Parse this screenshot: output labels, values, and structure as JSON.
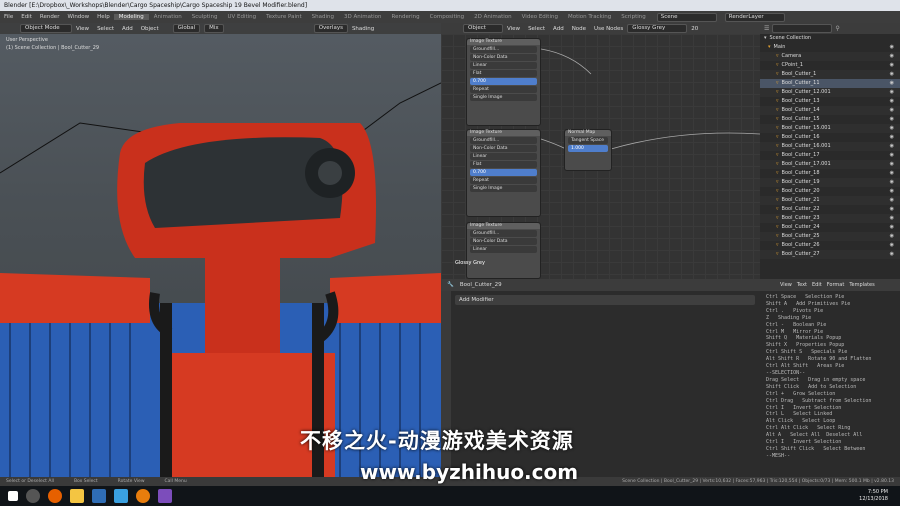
{
  "window": {
    "title": "Blender [E:\\Dropbox\\_Workshops\\Blender\\Cargo Spaceship\\Cargo Spaceship 19 Bevel Modifier.blend]"
  },
  "menubar": {
    "menus": [
      "File",
      "Edit",
      "Render",
      "Window",
      "Help"
    ],
    "workspaces": [
      "Modeling",
      "Animation",
      "Sculpting",
      "UV Editing",
      "Texture Paint",
      "Shading",
      "3D Animation",
      "Rendering",
      "Compositing",
      "2D Animation",
      "Video Editing",
      "Motion Tracking",
      "Scripting"
    ],
    "active_workspace": "Modeling",
    "scene": "Scene",
    "view_layer": "RenderLayer"
  },
  "viewport": {
    "mode": "Object Mode",
    "menus": [
      "View",
      "Select",
      "Add",
      "Object"
    ],
    "transform": "Global",
    "pivot": "Mix",
    "overlays": "Overlays",
    "shading": "Shading",
    "view_name": "User Perspective",
    "collection_path": "(1) Scene Collection | Bool_Cutter_29"
  },
  "node_editor": {
    "editor_type": "Object",
    "menus": [
      "View",
      "Select",
      "Add",
      "Node"
    ],
    "use_nodes": "Use Nodes",
    "material": "Glossy Grey",
    "users": "20",
    "nodes": [
      {
        "title": "Image Texture",
        "rows": [
          "Color",
          "Alpha",
          "Groundfill...",
          "Non-Color Data",
          "Linear",
          "Flat",
          "Repeat",
          "Single Image",
          "Vector"
        ],
        "value": "0.700"
      },
      {
        "title": "Normal Map",
        "rows": [
          "Normal",
          "Tangent Space",
          "Strength",
          "Color"
        ],
        "strength": "1.000"
      },
      {
        "title": "Image Texture",
        "rows": [
          "Color",
          "Alpha",
          "Groundfill...",
          "Non-Color Data",
          "Linear",
          "Flat",
          "Repeat",
          "Single Image",
          "Vector"
        ],
        "value": "0.700"
      },
      {
        "title": "Image Texture",
        "rows": [
          "Color",
          "Alpha",
          "Groundfill...",
          "Non-Color Data",
          "Linear",
          "Flat"
        ],
        "value": ""
      }
    ],
    "node_label": "Glossy Grey"
  },
  "outliner": {
    "search_placeholder": "",
    "root": "Scene Collection",
    "items": [
      "Main",
      "Camera",
      "CPoint_1",
      "Bool_Cutter_1",
      "Bool_Cutter_11",
      "Bool_Cutter_12.001",
      "Bool_Cutter_13",
      "Bool_Cutter_14",
      "Bool_Cutter_15",
      "Bool_Cutter_15.001",
      "Bool_Cutter_16",
      "Bool_Cutter_16.001",
      "Bool_Cutter_17",
      "Bool_Cutter_17.001",
      "Bool_Cutter_18",
      "Bool_Cutter_19",
      "Bool_Cutter_20",
      "Bool_Cutter_21",
      "Bool_Cutter_22",
      "Bool_Cutter_23",
      "Bool_Cutter_24",
      "Bool_Cutter_25",
      "Bool_Cutter_26",
      "Bool_Cutter_27"
    ],
    "selected": "Bool_Cutter_11"
  },
  "properties": {
    "object": "Bool_Cutter_29",
    "add_modifier": "Add Modifier"
  },
  "text_editor": {
    "menus": [
      "View",
      "Text",
      "Edit",
      "Format",
      "Templates"
    ],
    "lines": [
      "Ctrl Space   Selection Pie",
      "Shift A   Add Primitives Pie",
      "Ctrl .   Pivots Pie",
      "Z   Shading Pie",
      "Ctrl -   Boolean Pie",
      "Ctrl M   Mirror Pie",
      "Shift Q   Materials Popup",
      "Shift X   Properties Popup",
      "Ctrl Shift S   Specials Pie",
      "Alt Shift R   Rotate 90 and Flatten",
      "Ctrl Alt Shift   Areas Pie",
      "",
      "--SELECTION--",
      "Drag Select   Drag in empty space",
      "Shift Click   Add to Selection",
      "Ctrl +   Grow Selection",
      "Ctrl Drag   Subtract from Selection",
      "Ctrl I   Invert Selection",
      "Ctrl L   Select Linked",
      "Alt Click   Select Loop",
      "Ctrl Alt Click   Select Ring",
      "Alt A   Select All  Deselect All",
      "Ctrl I   Invert Selection",
      "Ctrl Shift Click   Select Between",
      "",
      "--MESH--"
    ]
  },
  "statusbar": {
    "left": [
      "Select or Deselect All",
      "Box Select",
      "Rotate View",
      "Call Menu"
    ],
    "right": "Scene Collection | Bool_Cutter_29 | Verts:10,632 | Faces:57,963 | Tris:120,554 | Objects:0/73 | Mem: 500.1 Mb | v2.80.13"
  },
  "taskbar": {
    "time": "7:50 PM",
    "date": "12/13/2018"
  },
  "watermark": {
    "line1": "不移之火-动漫游戏美术资源",
    "line2": "www.byzhihuo.com"
  }
}
